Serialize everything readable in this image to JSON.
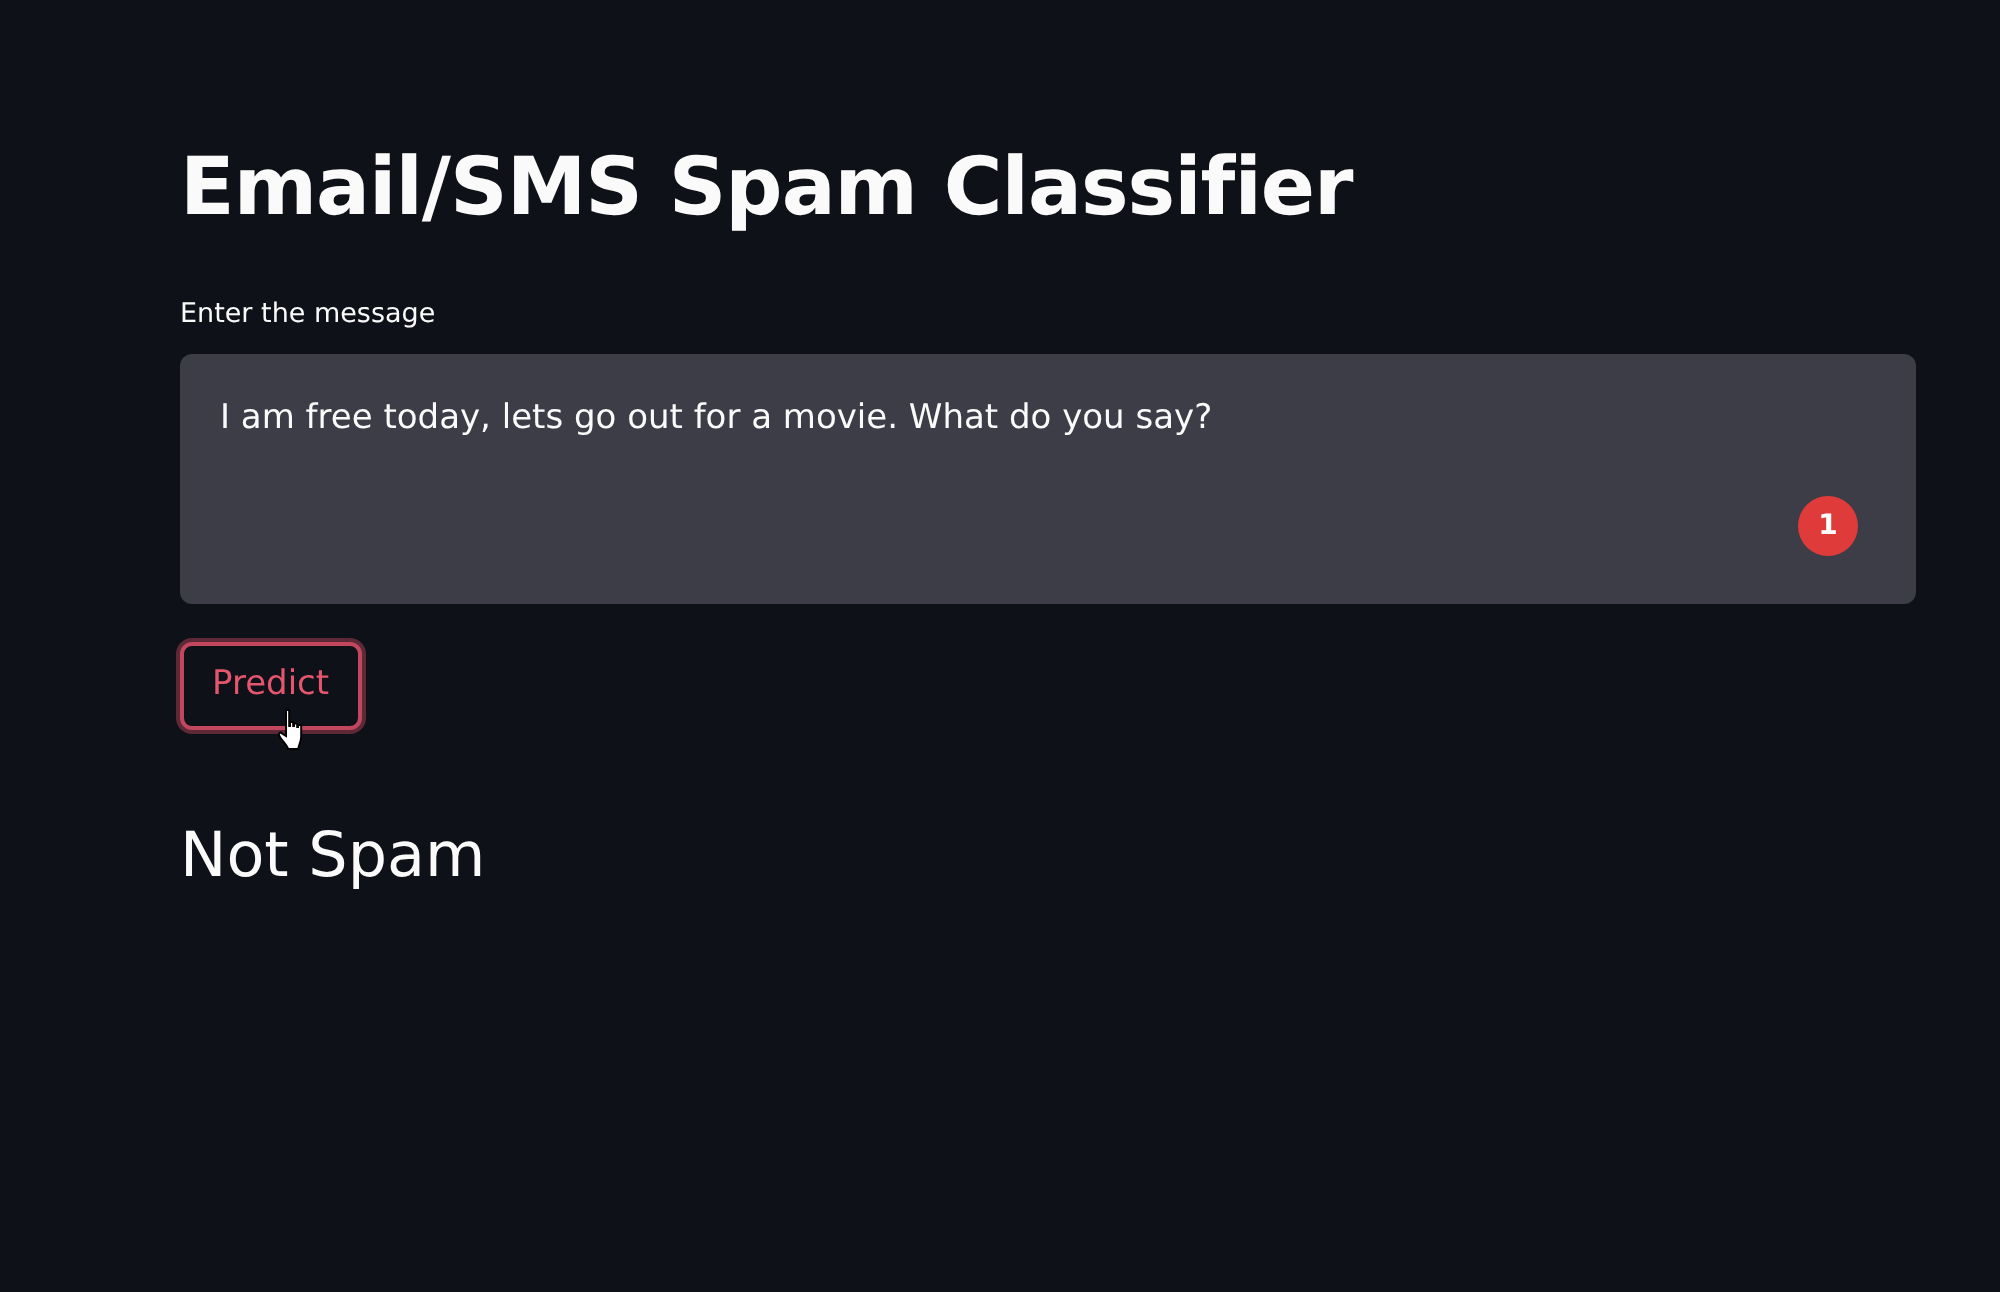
{
  "title": "Email/SMS Spam Classifier",
  "message_field": {
    "label": "Enter the message",
    "value": "I am free today, lets go out for a movie. What do you say?",
    "badge": "1"
  },
  "predict_button": {
    "label": "Predict",
    "focused": true
  },
  "result": "Not Spam"
}
